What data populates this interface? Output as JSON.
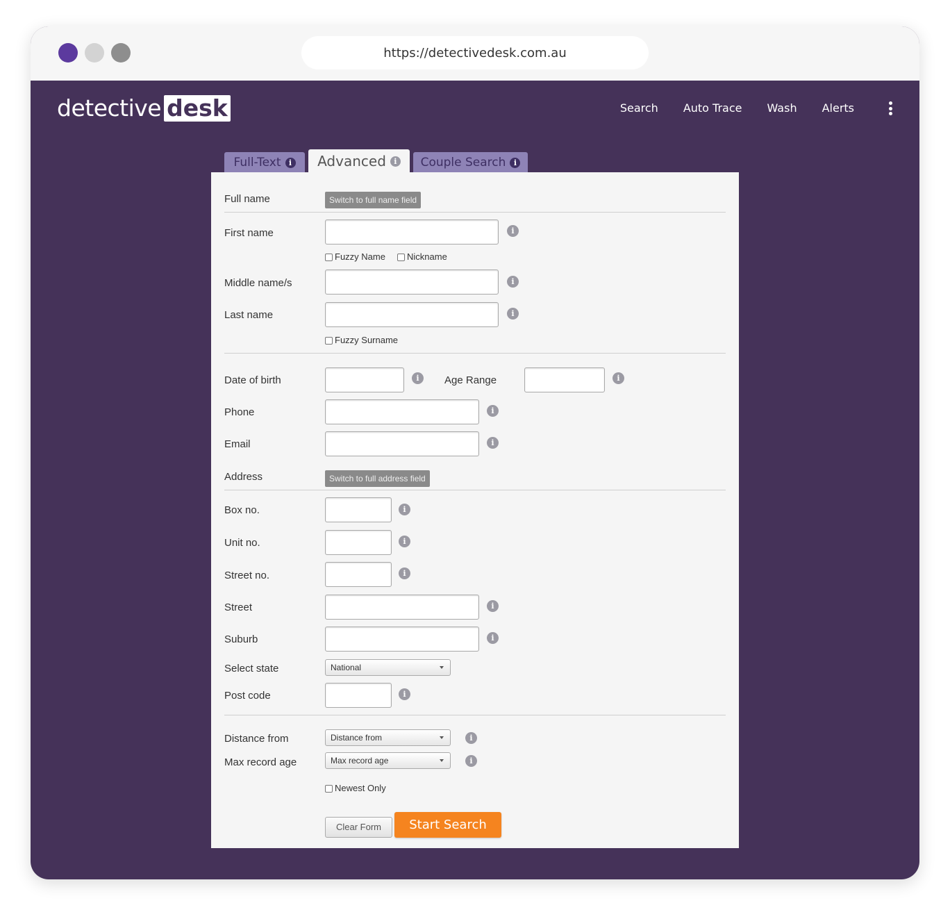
{
  "browser": {
    "url": "https://detectivedesk.com.au"
  },
  "logo": {
    "part1": "detective",
    "part2": "desk"
  },
  "nav": {
    "items": [
      "Search",
      "Auto Trace",
      "Wash",
      "Alerts"
    ]
  },
  "tabs": [
    {
      "label": "Full-Text",
      "active": false
    },
    {
      "label": "Advanced",
      "active": true
    },
    {
      "label": "Couple Search",
      "active": false
    }
  ],
  "form": {
    "full_name_label": "Full name",
    "switch_full_name": "Switch to full name field",
    "first_name_label": "First name",
    "fuzzy_name": "Fuzzy Name",
    "nickname": "Nickname",
    "middle_names_label": "Middle name/s",
    "last_name_label": "Last name",
    "fuzzy_surname": "Fuzzy Surname",
    "dob_label": "Date of birth",
    "age_range_label": "Age Range",
    "phone_label": "Phone",
    "email_label": "Email",
    "address_label": "Address",
    "switch_full_address": "Switch to full address field",
    "box_label": "Box no.",
    "unit_label": "Unit no.",
    "street_no_label": "Street no.",
    "street_label": "Street",
    "suburb_label": "Suburb",
    "state_label": "Select state",
    "state_value": "National",
    "postcode_label": "Post code",
    "distance_label": "Distance from",
    "distance_value": "Distance from",
    "max_age_label": "Max record age",
    "max_age_value": "Max record age",
    "newest_only": "Newest Only",
    "clear_button": "Clear Form",
    "start_button": "Start Search"
  },
  "colors": {
    "accent_purple": "#453259",
    "tab_inactive": "#8e83b6",
    "start_orange": "#f5841f"
  },
  "icons": {
    "info": "info-circle-icon",
    "menu": "kebab-menu-icon"
  }
}
